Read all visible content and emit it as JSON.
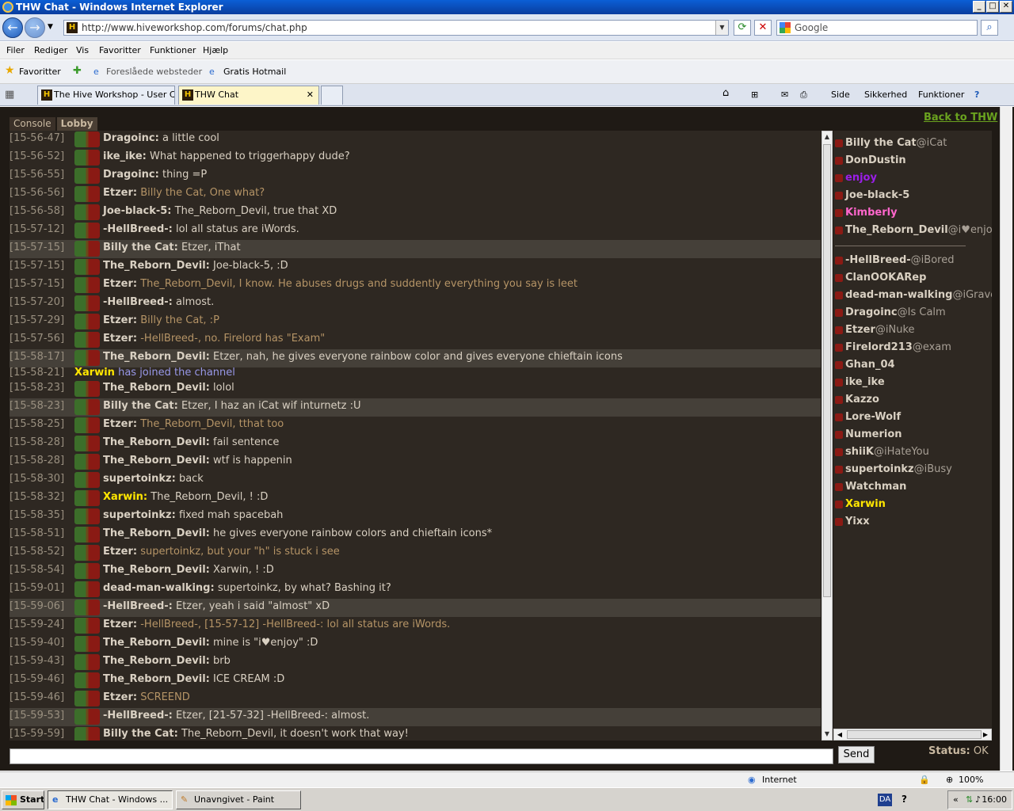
{
  "window": {
    "title": "THW Chat - Windows Internet Explorer",
    "min": "_",
    "max": "□",
    "close": "✕"
  },
  "browser": {
    "url": "http://www.hiveworkshop.com/forums/chat.php",
    "search_placeholder": "Google",
    "menu": [
      "Filer",
      "Rediger",
      "Vis",
      "Favoritter",
      "Funktioner",
      "Hjælp"
    ],
    "favbar": {
      "favorites": "Favoritter",
      "suggested": "Foreslåede websteder",
      "hotmail": "Gratis Hotmail"
    },
    "tabs": [
      {
        "label": "The Hive Workshop - User C..."
      },
      {
        "label": "THW Chat"
      }
    ],
    "tools": {
      "side": "Side",
      "security": "Sikkerhed",
      "functions": "Funktioner"
    },
    "status": {
      "zone": "Internet",
      "zoom": "100%"
    }
  },
  "chat": {
    "tabs": [
      "Console",
      "Lobby"
    ],
    "back_link": "Back to THW",
    "send_label": "Send",
    "status_label": "Status:",
    "status_value": "OK",
    "messages": [
      {
        "t": "[15-56-47]",
        "n": "Dragoinc:",
        "m": "a little cool",
        "c": ""
      },
      {
        "t": "[15-56-52]",
        "n": "ike_ike:",
        "m": "What happened to triggerhappy dude?",
        "c": ""
      },
      {
        "t": "[15-56-55]",
        "n": "Dragoinc:",
        "m": "thing =P",
        "c": ""
      },
      {
        "t": "[15-56-56]",
        "n": "Etzer:",
        "m": "Billy the Cat, One what?",
        "c": "etz"
      },
      {
        "t": "[15-56-58]",
        "n": "Joe-black-5:",
        "m": "The_Reborn_Devil, true that XD",
        "c": ""
      },
      {
        "t": "[15-57-12]",
        "n": "-HellBreed-:",
        "m": "lol all status are iWords.",
        "c": ""
      },
      {
        "t": "[15-57-15]",
        "n": "Billy the Cat:",
        "m": "Etzer, iThat",
        "c": "",
        "hl": true
      },
      {
        "t": "[15-57-15]",
        "n": "The_Reborn_Devil:",
        "m": "Joe-black-5, :D",
        "c": ""
      },
      {
        "t": "[15-57-15]",
        "n": "Etzer:",
        "m": "The_Reborn_Devil, I know. He abuses drugs and suddently everything you say is leet",
        "c": "etz"
      },
      {
        "t": "[15-57-20]",
        "n": "-HellBreed-:",
        "m": "almost.",
        "c": ""
      },
      {
        "t": "[15-57-29]",
        "n": "Etzer:",
        "m": "Billy the Cat, :P",
        "c": "etz"
      },
      {
        "t": "[15-57-56]",
        "n": "Etzer:",
        "m": "-HellBreed-, no. Firelord has \"Exam\"",
        "c": "etz"
      },
      {
        "t": "[15-58-17]",
        "n": "The_Reborn_Devil:",
        "m": "Etzer, nah, he gives everyone rainbow color and gives everyone chieftain icons",
        "c": "",
        "hl": true
      },
      {
        "t": "[15-58-21]",
        "n": "Xarwin",
        "m": "has joined the channel",
        "c": "sysm",
        "sys": true,
        "y": true
      },
      {
        "t": "[15-58-23]",
        "n": "The_Reborn_Devil:",
        "m": "lolol",
        "c": ""
      },
      {
        "t": "[15-58-23]",
        "n": "Billy the Cat:",
        "m": "Etzer, I haz an iCat wif inturnetz :U",
        "c": "",
        "hl": true
      },
      {
        "t": "[15-58-25]",
        "n": "Etzer:",
        "m": "The_Reborn_Devil, tthat too",
        "c": "etz"
      },
      {
        "t": "[15-58-28]",
        "n": "The_Reborn_Devil:",
        "m": "fail sentence",
        "c": ""
      },
      {
        "t": "[15-58-28]",
        "n": "The_Reborn_Devil:",
        "m": "wtf is happenin",
        "c": ""
      },
      {
        "t": "[15-58-30]",
        "n": "supertoinkz:",
        "m": "back",
        "c": ""
      },
      {
        "t": "[15-58-32]",
        "n": "Xarwin:",
        "m": "The_Reborn_Devil, ! :D",
        "c": "",
        "y": true
      },
      {
        "t": "[15-58-35]",
        "n": "supertoinkz:",
        "m": "fixed mah spacebah",
        "c": ""
      },
      {
        "t": "[15-58-51]",
        "n": "The_Reborn_Devil:",
        "m": "he gives everyone rainbow colors and chieftain icons*",
        "c": ""
      },
      {
        "t": "[15-58-52]",
        "n": "Etzer:",
        "m": "supertoinkz, but your \"h\" is stuck i see",
        "c": "etz"
      },
      {
        "t": "[15-58-54]",
        "n": "The_Reborn_Devil:",
        "m": "Xarwin, ! :D",
        "c": ""
      },
      {
        "t": "[15-59-01]",
        "n": "dead-man-walking:",
        "m": "supertoinkz, by what? Bashing it?",
        "c": ""
      },
      {
        "t": "[15-59-06]",
        "n": "-HellBreed-:",
        "m": "Etzer, yeah i said \"almost\" xD",
        "c": "",
        "hl": true
      },
      {
        "t": "[15-59-24]",
        "n": "Etzer:",
        "m": "-HellBreed-, [15-57-12]  -HellBreed-: lol all status are iWords.",
        "c": "etz"
      },
      {
        "t": "[15-59-40]",
        "n": "The_Reborn_Devil:",
        "m": "mine is \"i♥enjoy\" :D",
        "c": ""
      },
      {
        "t": "[15-59-43]",
        "n": "The_Reborn_Devil:",
        "m": "brb",
        "c": ""
      },
      {
        "t": "[15-59-46]",
        "n": "The_Reborn_Devil:",
        "m": "ICE CREAM :D",
        "c": ""
      },
      {
        "t": "[15-59-46]",
        "n": "Etzer:",
        "m": "SCREEND",
        "c": "etz"
      },
      {
        "t": "[15-59-53]",
        "n": "-HellBreed-:",
        "m": "Etzer, [21-57-32]  -HellBreed-: almost.",
        "c": "",
        "hl": true
      },
      {
        "t": "[15-59-59]",
        "n": "Billy the Cat:",
        "m": "The_Reborn_Devil, it doesn't work that way!",
        "c": ""
      }
    ],
    "users_top": [
      {
        "name": "Billy the Cat",
        "status": "@iCat",
        "color": "#d9d0c2"
      },
      {
        "name": "DonDustin",
        "status": "",
        "color": "#d9d0c2"
      },
      {
        "name": "enjoy",
        "status": "",
        "color": "#9a1ee8"
      },
      {
        "name": "Joe-black-5",
        "status": "",
        "color": "#d9d0c2"
      },
      {
        "name": "Kimberly",
        "status": "",
        "color": "#ff66cc"
      },
      {
        "name": "The_Reborn_Devil",
        "status": "@i♥enjoy",
        "color": "#d9d0c2"
      }
    ],
    "users_bottom": [
      {
        "name": "-HellBreed-",
        "status": "@iBored",
        "color": "#d9d0c2"
      },
      {
        "name": "ClanOOKARep",
        "status": "",
        "color": "#d9d0c2"
      },
      {
        "name": "dead-man-walking",
        "status": "@iGrave",
        "color": "#d9d0c2"
      },
      {
        "name": "Dragoinc",
        "status": "@Is Calm",
        "color": "#d9d0c2"
      },
      {
        "name": "Etzer",
        "status": "@iNuke",
        "color": "#d9d0c2"
      },
      {
        "name": "Firelord213",
        "status": "@exam",
        "color": "#d9d0c2"
      },
      {
        "name": "Ghan_04",
        "status": "",
        "color": "#d9d0c2"
      },
      {
        "name": "ike_ike",
        "status": "",
        "color": "#d9d0c2"
      },
      {
        "name": "Kazzo",
        "status": "",
        "color": "#d9d0c2"
      },
      {
        "name": "Lore-Wolf",
        "status": "",
        "color": "#d9d0c2"
      },
      {
        "name": "Numerion",
        "status": "",
        "color": "#d9d0c2"
      },
      {
        "name": "shiiK",
        "status": "@iHateYou",
        "color": "#d9d0c2"
      },
      {
        "name": "supertoinkz",
        "status": "@iBusy",
        "color": "#d9d0c2"
      },
      {
        "name": "Watchman",
        "status": "",
        "color": "#d9d0c2"
      },
      {
        "name": "Xarwin",
        "status": "",
        "color": "#ffe600"
      },
      {
        "name": "Yixx",
        "status": "",
        "color": "#d9d0c2"
      }
    ]
  },
  "taskbar": {
    "start": "Start",
    "items": [
      "THW Chat - Windows ...",
      "Unavngivet - Paint"
    ],
    "lang": "DA",
    "clock": "16:00"
  }
}
